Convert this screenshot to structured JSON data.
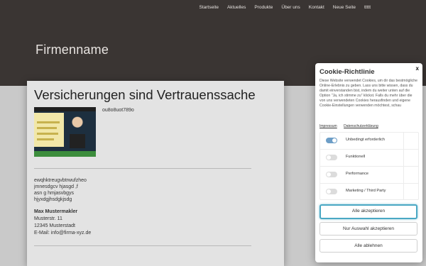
{
  "nav": [
    "Startseite",
    "Aktuelles",
    "Produkte",
    "Über uns",
    "Kontakt",
    "Neue Seite",
    "ttttt"
  ],
  "brand": "Firmenname",
  "main": {
    "heading": "Versicherungen sind Vertrauenssache",
    "code": "ou8o8uot789o",
    "lines": [
      "ewqhktreugvbtrwufzheo",
      "jmnesdgcv hjasgd ,f",
      "asn g hmjasvbgys",
      "hjyxdgjhsdgkjsdg"
    ],
    "address": {
      "name": "Max Mustermakler",
      "street": "Musterstr. 11",
      "city": "12345 Musterstadt",
      "email": "E-Mail: info@firma-xyz.de"
    }
  },
  "cookie": {
    "title": "Cookie-Richtlinie",
    "close": "x",
    "description": "Diese Website verwendet Cookies, um dir das bestmögliche Online-Erlebnis zu geben. Lass uns bitte wissen, dass du damit einverstanden bist, indem du weiter unten auf die Option \"Ja, ich stimme zu\" klickst. Falls du mehr über die von uns verwendeten Cookies herausfinden und eigene Cookie-Einstellungen verwenden möchtest, schau",
    "links": [
      "Impressum",
      "Datenschutzerklärung"
    ],
    "options": [
      {
        "label": "Unbedingt erforderlich",
        "on": true
      },
      {
        "label": "Funktionell",
        "on": false
      },
      {
        "label": "Performance",
        "on": false
      },
      {
        "label": "Marketing / Third Party",
        "on": false
      }
    ],
    "buttons": {
      "accept_all": "Alle akzeptieren",
      "accept_selection": "Nur Auswahl akzeptieren",
      "reject_all": "Alle ablehnen"
    }
  },
  "colors": {
    "header": "#3a3533",
    "page": "#c9c9c9",
    "accent": "#4aa8c4",
    "toggle_on": "#6d9ec7"
  }
}
